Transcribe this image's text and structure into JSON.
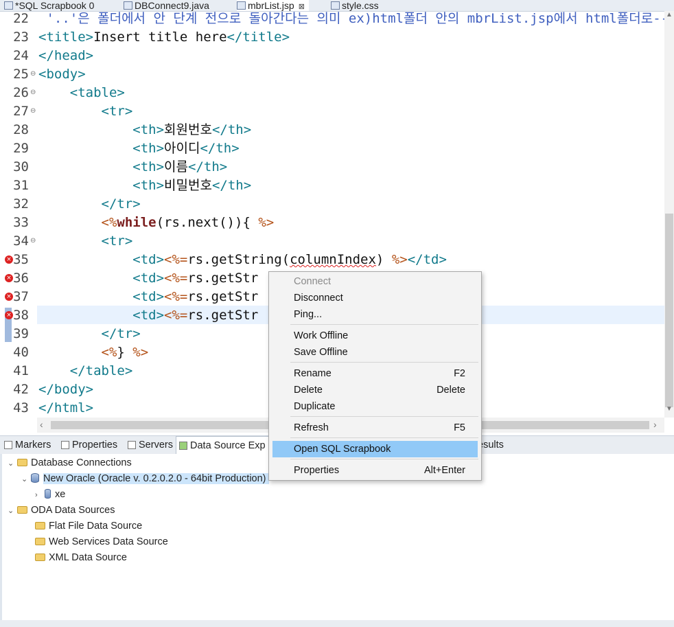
{
  "editor_tabs": [
    {
      "label": "*SQL Scrapbook 0"
    },
    {
      "label": "DBConnect9.java"
    },
    {
      "label": "mbrList.jsp",
      "close": "⊠"
    },
    {
      "label": "style.css"
    }
  ],
  "code_lines": [
    {
      "n": "22",
      "text": " '..'은 폴더에서 안 단계 전으로 돌아간다는 의미 ex)html폴더 안의 mbrList.jsp에서 html폴더로--%>"
    },
    {
      "n": "23",
      "a": "<title>",
      "b": "Insert title here",
      "c": "</title>"
    },
    {
      "n": "24",
      "a": "</head>"
    },
    {
      "n": "25",
      "a": "<body>"
    },
    {
      "n": "26",
      "a": "    <table>"
    },
    {
      "n": "27",
      "a": "        <tr>"
    },
    {
      "n": "28",
      "a": "            <th>",
      "b": "회원번호",
      "c": "</th>"
    },
    {
      "n": "29",
      "a": "            <th>",
      "b": "아이디",
      "c": "</th>"
    },
    {
      "n": "30",
      "a": "            <th>",
      "b": "이름",
      "c": "</th>"
    },
    {
      "n": "31",
      "a": "            <th>",
      "b": "비밀번호",
      "c": "</th>"
    },
    {
      "n": "32",
      "a": "        </tr>"
    },
    {
      "n": "33",
      "pre": "        ",
      "j1": "<%",
      "kw": "while",
      "b": "(rs.next()){ ",
      "j2": "%>"
    },
    {
      "n": "34",
      "a": "        <tr>"
    },
    {
      "n": "35",
      "a": "            <td>",
      "j1": "<%=",
      "b": "rs.getString(",
      "sq": "columnIndex",
      "b2": ") ",
      "j2": "%>",
      "c": "</td>"
    },
    {
      "n": "36",
      "a": "            <td>",
      "j1": "<%=",
      "b": "rs.getStr"
    },
    {
      "n": "37",
      "a": "            <td>",
      "j1": "<%=",
      "b": "rs.getStr"
    },
    {
      "n": "38",
      "a": "            <td>",
      "j1": "<%=",
      "b": "rs.getStr"
    },
    {
      "n": "39",
      "a": "        </tr>"
    },
    {
      "n": "40",
      "pre": "        ",
      "j1": "<%",
      "b": "} ",
      "j2": "%>"
    },
    {
      "n": "41",
      "a": "    </table>"
    },
    {
      "n": "42",
      "a": "</body>"
    },
    {
      "n": "43",
      "a": "</html>"
    }
  ],
  "view_tabs": {
    "markers": "Markers",
    "properties": "Properties",
    "servers": "Servers",
    "data_source": "Data Source Exp",
    "results": "esults"
  },
  "tree": {
    "db_connections": "Database Connections",
    "new_oracle": "New Oracle (Oracle v. 0.2.0.2.0 - 64bit Production)",
    "xe": "xe",
    "oda_sources": "ODA Data Sources",
    "flat_file": "Flat File Data Source",
    "web_services": "Web Services Data Source",
    "xml": "XML Data Source"
  },
  "context_menu": {
    "connect": "Connect",
    "disconnect": "Disconnect",
    "ping": "Ping...",
    "work_offline": "Work Offline",
    "save_offline": "Save Offline",
    "rename": "Rename",
    "rename_sc": "F2",
    "delete": "Delete",
    "delete_sc": "Delete",
    "duplicate": "Duplicate",
    "refresh": "Refresh",
    "refresh_sc": "F5",
    "open_sql_scrapbook": "Open SQL Scrapbook",
    "properties": "Properties",
    "properties_sc": "Alt+Enter"
  }
}
